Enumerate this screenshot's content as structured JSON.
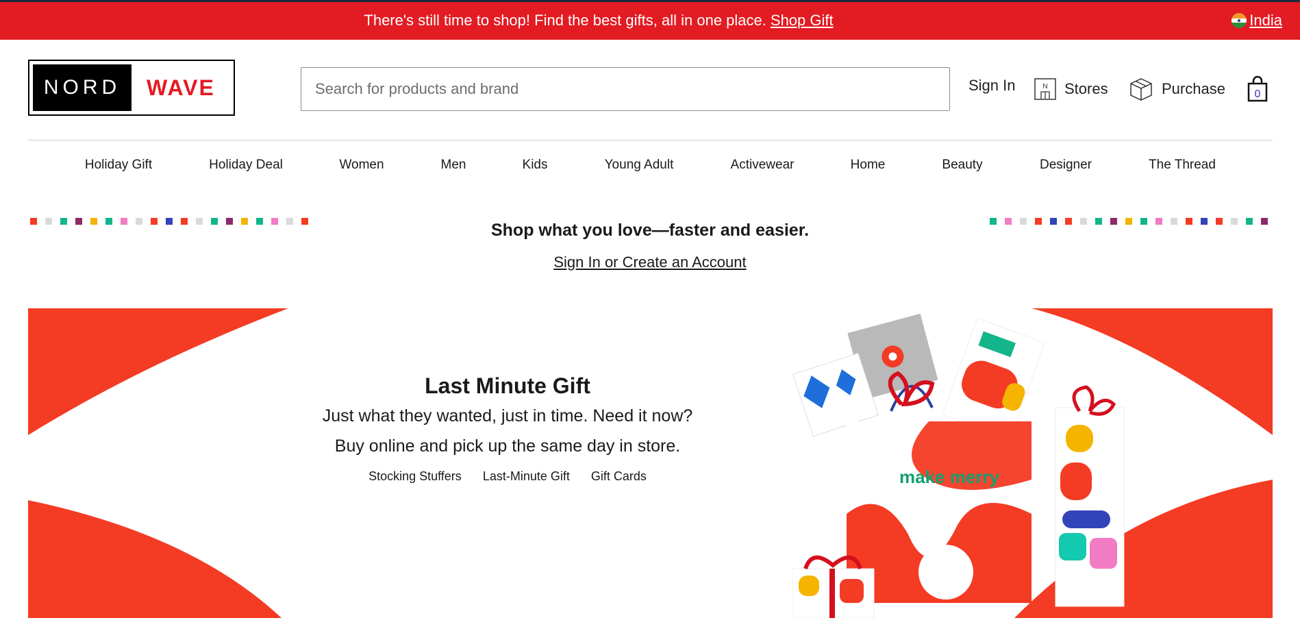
{
  "colors": {
    "brand_red": "#e31b23",
    "hero_red": "#f43b24",
    "text": "#1a1a1a"
  },
  "promo_bar": {
    "message": "There's still time to shop! Find the best gifts, all in one place.",
    "link_label": "Shop Gift",
    "region_label": "India",
    "region_icon": "india-flag-icon"
  },
  "header": {
    "logo_left": "NORD",
    "logo_right": "WAVE",
    "search_placeholder": "Search for products and brand",
    "sign_in_label": "Sign In",
    "stores_label": "Stores",
    "purchase_label": "Purchase",
    "bag_count": "0",
    "icons": [
      "store-icon",
      "box-icon",
      "shopping-bag-icon"
    ]
  },
  "nav": {
    "items": [
      "Holiday Gift",
      "Holiday Deal",
      "Women",
      "Men",
      "Kids",
      "Young Adult",
      "Activewear",
      "Home",
      "Beauty",
      "Designer",
      "The Thread"
    ]
  },
  "signin_prompt": {
    "headline": "Shop what you love—faster and easier.",
    "link_label": "Sign In or Create an Account"
  },
  "hero": {
    "title": "Last Minute Gift",
    "line1": "Just what they wanted, just in time. Need it now?",
    "line2": "Buy online and pick up the same day in store.",
    "links": [
      "Stocking Stuffers",
      "Last-Minute Gift",
      "Gift Cards"
    ],
    "bag_print": "make merry"
  }
}
